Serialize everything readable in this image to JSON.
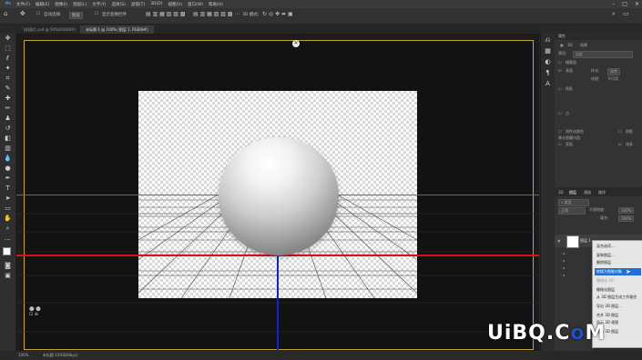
{
  "menu": {
    "items": [
      "文件(F)",
      "编辑(E)",
      "图像(I)",
      "图层(L)",
      "文字(Y)",
      "选择(S)",
      "滤镜(T)",
      "3D(D)",
      "视图(V)",
      "窗口(W)",
      "帮助(H)"
    ]
  },
  "options": {
    "auto_select": "自动选择:",
    "layer_dropdown": "图层",
    "show_transform": "显示变换控件",
    "mode_3d": "3D 模式:"
  },
  "tabs": [
    {
      "label": "飞机面片.psd @ 50%(RGB/8#)"
    },
    {
      "label": "未标题-1 @ 100% (图层 1, RGB/8#)"
    }
  ],
  "status": {
    "zoom": "100%",
    "doc": "未标题-1(RGB/8bpc)"
  },
  "properties": {
    "tab_label": "属性",
    "row1": "3D",
    "row2": "场景",
    "preset_label": "预设:",
    "preset_value": "自定",
    "cross_section": "横截面",
    "surface": "表面",
    "style_label": "样式:",
    "style_value": "实色",
    "texture_label": "纹理:",
    "texture_value": "不可用",
    "lines": "线条",
    "points": "点",
    "linearize": "线性化颜色",
    "remove_hidden": "移去隐藏内容:",
    "back": "背面",
    "line_item": "线条",
    "shadow": "阴影"
  },
  "layers_panel": {
    "tabs": [
      "3D",
      "图层",
      "通道",
      "路径"
    ],
    "blend_mode": "正常",
    "opacity_label": "不透明度:",
    "opacity_value": "100%",
    "fill_label": "填充:",
    "fill_value": "100%",
    "layer_name": "图层 1"
  },
  "context_menu": {
    "items": [
      {
        "label": "混合选项...",
        "state": "normal"
      },
      {
        "label": "复制图层...",
        "state": "normal"
      },
      {
        "label": "删除图层",
        "state": "normal"
      },
      {
        "label": "转换为智能对象",
        "state": "selected"
      },
      {
        "label": "栅格化 3D",
        "state": "disabled"
      },
      {
        "label": "栅格化图层",
        "state": "normal"
      },
      {
        "label": "从 3D 图层生成工作路径",
        "state": "normal"
      },
      {
        "label": "导出 3D 图层...",
        "state": "normal"
      },
      {
        "label": "合并 3D 图层",
        "state": "normal"
      },
      {
        "label": "显示 3D 视图",
        "state": "normal"
      },
      {
        "label": "渲染 3D 图层",
        "state": "normal"
      }
    ]
  },
  "watermark": {
    "text_a": "UiBQ.C",
    "text_b": "o",
    "text_c": "M"
  },
  "colors": {
    "accent_red": "#e01010",
    "accent_blue": "#1420d8",
    "doc_border": "#c8a23a",
    "menu_highlight": "#1e6fd9"
  }
}
